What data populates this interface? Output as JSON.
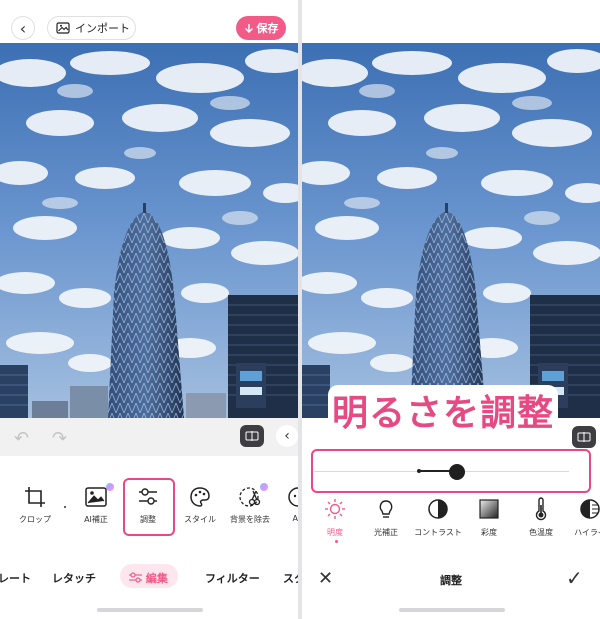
{
  "left": {
    "topbar": {
      "back_icon": "‹",
      "import_label": "インポート",
      "save_label": "保存"
    },
    "tools": [
      {
        "name": "crop",
        "label": "クロップ"
      },
      {
        "name": "ai-enhance",
        "label": "AI補正"
      },
      {
        "name": "adjust",
        "label": "調整"
      },
      {
        "name": "style",
        "label": "スタイル"
      },
      {
        "name": "remove-background",
        "label": "背景を除去"
      },
      {
        "name": "ar",
        "label": "AR"
      }
    ],
    "categories": [
      "レート",
      "レタッチ",
      "編集",
      "フィルター",
      "スタ"
    ],
    "active_category": "編集"
  },
  "right": {
    "annotation": "明るさを調整",
    "slider": {
      "value": 0.56
    },
    "adjustments": [
      {
        "name": "brightness",
        "label": "明度"
      },
      {
        "name": "light-correction",
        "label": "光補正"
      },
      {
        "name": "contrast",
        "label": "コントラスト"
      },
      {
        "name": "saturation",
        "label": "彩度"
      },
      {
        "name": "color-temperature",
        "label": "色温度"
      },
      {
        "name": "highlight",
        "label": "ハイライ"
      }
    ],
    "bottom": {
      "title": "調整"
    }
  },
  "colors": {
    "accent": "#f25b88",
    "highlight_border": "#e74a82"
  }
}
